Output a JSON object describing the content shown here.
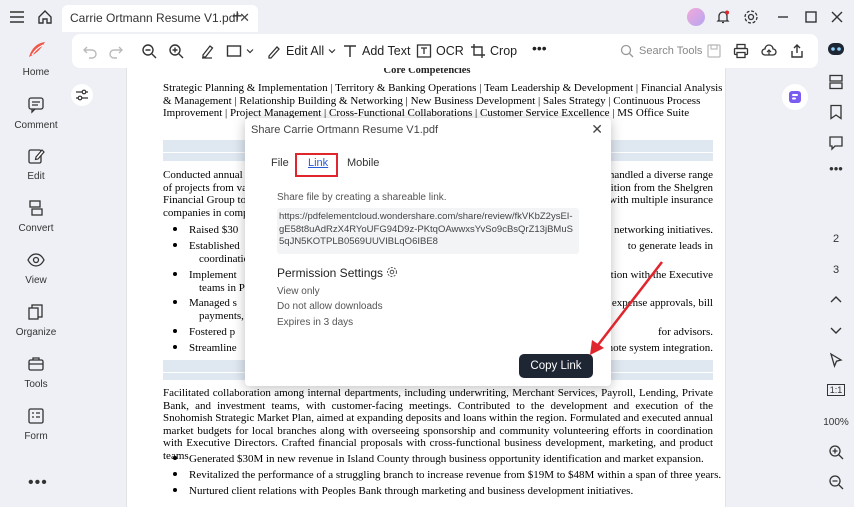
{
  "window": {
    "tab_title": "Carrie Ortmann Resume V1.pdf"
  },
  "sidebar": {
    "items": [
      {
        "label": "Home"
      },
      {
        "label": "Comment"
      },
      {
        "label": "Edit"
      },
      {
        "label": "Convert"
      },
      {
        "label": "View"
      },
      {
        "label": "Organize"
      },
      {
        "label": "Tools"
      },
      {
        "label": "Form"
      }
    ]
  },
  "toolbar": {
    "edit_all": "Edit All",
    "add_text": "Add Text",
    "ocr": "OCR",
    "crop": "Crop",
    "search_placeholder": "Search Tools"
  },
  "document": {
    "heading": "Core Competencies",
    "competencies": [
      "Strategic Planning & Implementation | Territory & Banking Operations | Team Leadership & Development | Financial Analysis",
      "& Management | Relationship Building & Networking | New Business Development | Sales Strategy | Continuous Process",
      "Improvement | Project Management | Cross-Functional Collaborations | Customer Service Excellence | MS Office Suite"
    ],
    "para1_left": [
      "Conducted annual",
      "of projects from va",
      "Financial Group to",
      "companies in comp"
    ],
    "para1_right": [
      "handled a diverse range",
      "sition from the Shelgren",
      "with multiple insurance",
      ""
    ],
    "bullets1_left": [
      "Raised $30",
      "Established",
      "coordinatio",
      "Implement",
      "teams in P",
      "Managed s",
      "payments,",
      "Fostered p",
      "Streamline"
    ],
    "bullets1_right": [
      "networking initiatives.",
      "to generate leads in",
      "",
      "ration with the Executive",
      "",
      "expense approvals, bill",
      "",
      "for advisors.",
      "note system integration."
    ],
    "para2": "Facilitated collaboration among internal departments, including underwriting, Merchant Services, Payroll, Lending, Private Bank, and investment teams, with customer-facing meetings. Contributed to the development and execution of the Snohomish Strategic Market Plan, aimed at expanding deposits and loans within the region. Formulated and executed annual market budgets for local branches along with overseeing sponsorship and community volunteering efforts in coordination with Executive Directors. Crafted financial proposals with cross-functional business development, marketing, and product teams.",
    "bullets2": [
      "Generated $30M in new revenue in Island County through business opportunity identification and market expansion.",
      "Revitalized the performance of a struggling branch to increase revenue from $19M to $48M within a span of three years.",
      "Nurtured client relations with Peoples Bank through marketing and business development initiatives."
    ]
  },
  "right_panel": {
    "page_2": "2",
    "page_3": "3",
    "zoom_fit": "1:1",
    "zoom": "100%"
  },
  "dialog": {
    "title": "Share Carrie Ortmann Resume V1.pdf",
    "tabs": [
      "File",
      "Link",
      "Mobile"
    ],
    "description": "Share file by creating a shareable link.",
    "url": "https://pdfelementcloud.wondershare.com/share/review/fkVKbZ2ysEI-gE58t8uAdRzX4RYoUFG94D9z-PKtqOAwwxsYvSo9cBsQrZ13jBMuS5qJN5KOTPLB0569UUVIBLqO6IBE8",
    "permission_title": "Permission Settings",
    "permissions": [
      "View only",
      "Do not allow downloads",
      "Expires in 3 days"
    ],
    "copy_button": "Copy Link"
  },
  "colors": {
    "highlight_red": "#e0252d",
    "button_dark": "#1f2633",
    "link_blue": "#2a5bd7"
  }
}
